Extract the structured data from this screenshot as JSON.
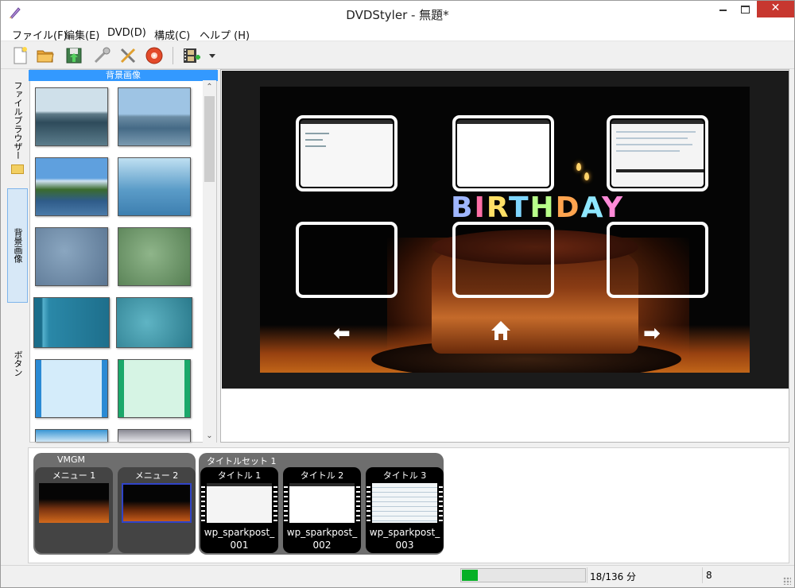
{
  "window": {
    "title": "DVDStyler - 無題*"
  },
  "menubar": [
    "ファイル(F)",
    "編集(E)",
    "DVD(D)",
    "構成(C)",
    "ヘルプ (H)"
  ],
  "toolbar": {
    "icons": [
      "new-icon",
      "open-icon",
      "save-icon",
      "properties-icon",
      "settings-icon",
      "burn-icon",
      "add-video-icon",
      "dropdown-icon"
    ]
  },
  "side_tabs": {
    "files": "ファイルブラウザー",
    "backgrounds": "背景画像",
    "buttons": "ボタン"
  },
  "panel": {
    "header": "背景画像"
  },
  "canvas": {
    "birthday_text": "BIRTHDAY"
  },
  "titleset_strip": {
    "vmgm_label": "VMGM",
    "titleset_label": "タイトルセット 1",
    "menus": [
      {
        "label": "メニュー 1"
      },
      {
        "label": "メニュー 2"
      }
    ],
    "titles": [
      {
        "label": "タイトル 1",
        "file_line1": "wp_sparkpost_",
        "file_line2": "001"
      },
      {
        "label": "タイトル 2",
        "file_line1": "wp_sparkpost_",
        "file_line2": "002"
      },
      {
        "label": "タイトル 3",
        "file_line1": "wp_sparkpost_",
        "file_line2": "003"
      }
    ]
  },
  "status": {
    "progress_fraction": 0.13,
    "duration_text": "18/136 分",
    "count": "8",
    "progress_color": "#06b025"
  }
}
